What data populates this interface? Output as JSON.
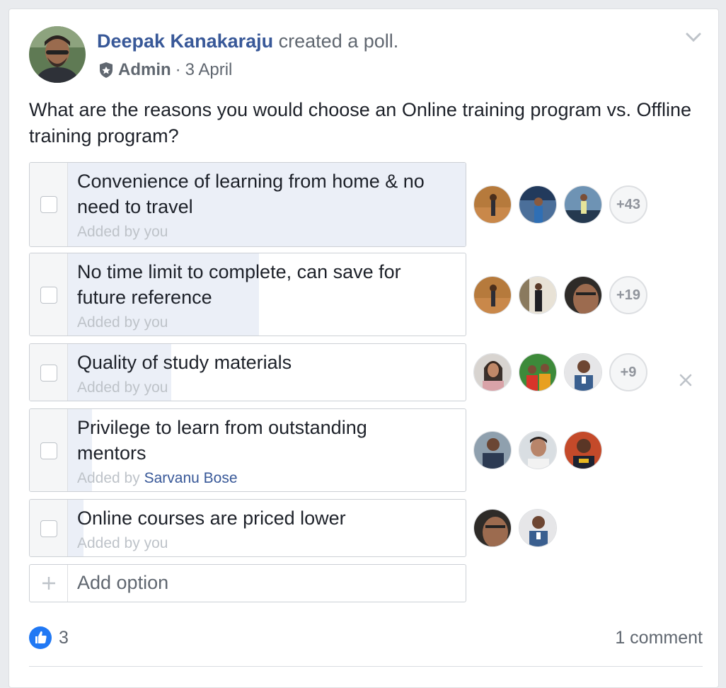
{
  "post": {
    "author": "Deepak Kanakaraju",
    "action": "created a poll.",
    "role": "Admin",
    "date_sep": "·",
    "date": "3 April",
    "question": "What are the reasons you would choose an Online training program vs. Offline training program?"
  },
  "poll": {
    "options": [
      {
        "line1": "Convenience of learning from home & no",
        "line2": "need to travel",
        "added_prefix": "Added by",
        "added_by": "you",
        "fill_fraction": 1.0,
        "more_voters": "+43"
      },
      {
        "line1": "No time limit to complete, can save for",
        "line2": "future reference",
        "added_prefix": "Added by",
        "added_by": "you",
        "fill_fraction": 0.48,
        "more_voters": "+19"
      },
      {
        "line1": "Quality of study materials",
        "line2": "",
        "added_prefix": "Added by",
        "added_by": "you",
        "fill_fraction": 0.26,
        "more_voters": "+9"
      },
      {
        "line1": "Privilege to learn from outstanding",
        "line2": "mentors",
        "added_prefix": "Added by",
        "added_by": "Sarvanu Bose",
        "fill_fraction": 0.06,
        "more_voters": ""
      },
      {
        "line1": "Online courses are priced lower",
        "line2": "",
        "added_prefix": "Added by",
        "added_by": "you",
        "fill_fraction": 0.04,
        "more_voters": ""
      }
    ],
    "add_option_placeholder": "Add option"
  },
  "footer": {
    "like_count": "3",
    "comments": "1 comment"
  },
  "colors": {
    "link": "#385898",
    "bar_fill": "#ebeff7",
    "like": "#2078f4"
  },
  "icons": [
    "chevron-down-icon",
    "admin-shield-icon",
    "close-icon",
    "plus-icon",
    "like-icon"
  ]
}
